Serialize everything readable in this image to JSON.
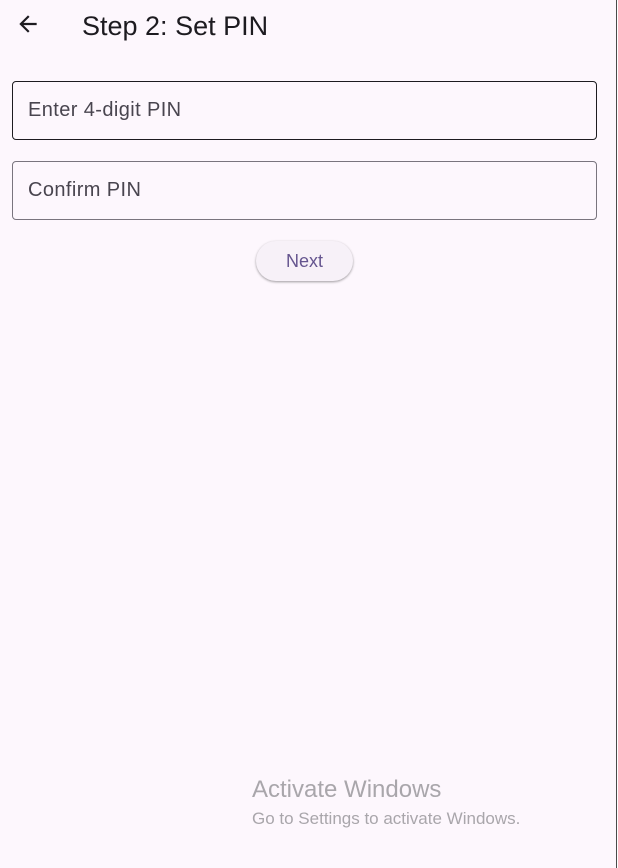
{
  "app_bar": {
    "back_icon": "arrow-back-icon",
    "title": "Step 2: Set PIN"
  },
  "form": {
    "pin_placeholder": "Enter 4-digit PIN",
    "pin_value": "",
    "confirm_placeholder": "Confirm PIN",
    "confirm_value": "",
    "next_label": "Next"
  },
  "watermark": {
    "title": "Activate Windows",
    "subtitle": "Go to Settings to activate Windows."
  },
  "colors": {
    "background": "#fdf7fd",
    "accent": "#65558f",
    "text": "#1d1b20",
    "outline": "#79747e"
  }
}
